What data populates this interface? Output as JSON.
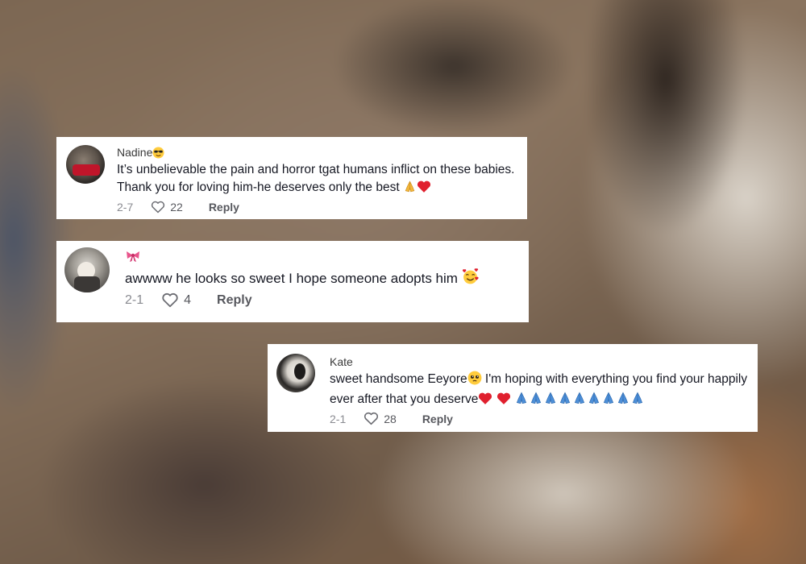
{
  "comments": [
    {
      "username": "Nadine",
      "username_emoji": "sunglasses-face-icon",
      "text": "It’s unbelievable the pain and horror tgat humans inflict on these babies. Thank you for loving him-he deserves only the best",
      "date": "2-7",
      "likes": "22",
      "reply_label": "Reply"
    },
    {
      "username": "",
      "username_emoji": "pink-bow-icon",
      "text": "awwww he looks so sweet I hope someone adopts him",
      "date": "2-1",
      "likes": "4",
      "reply_label": "Reply"
    },
    {
      "username": "Kate",
      "text_part1": "sweet handsome Eeyore",
      "text_part2": " I'm hoping with everything you find your happily ever after that you deserve",
      "date": "2-1",
      "likes": "28",
      "reply_label": "Reply"
    }
  ],
  "colors": {
    "card_bg": "#ffffff",
    "text": "#161823",
    "muted": "#8a8b91",
    "heart_red": "#e0202e"
  }
}
